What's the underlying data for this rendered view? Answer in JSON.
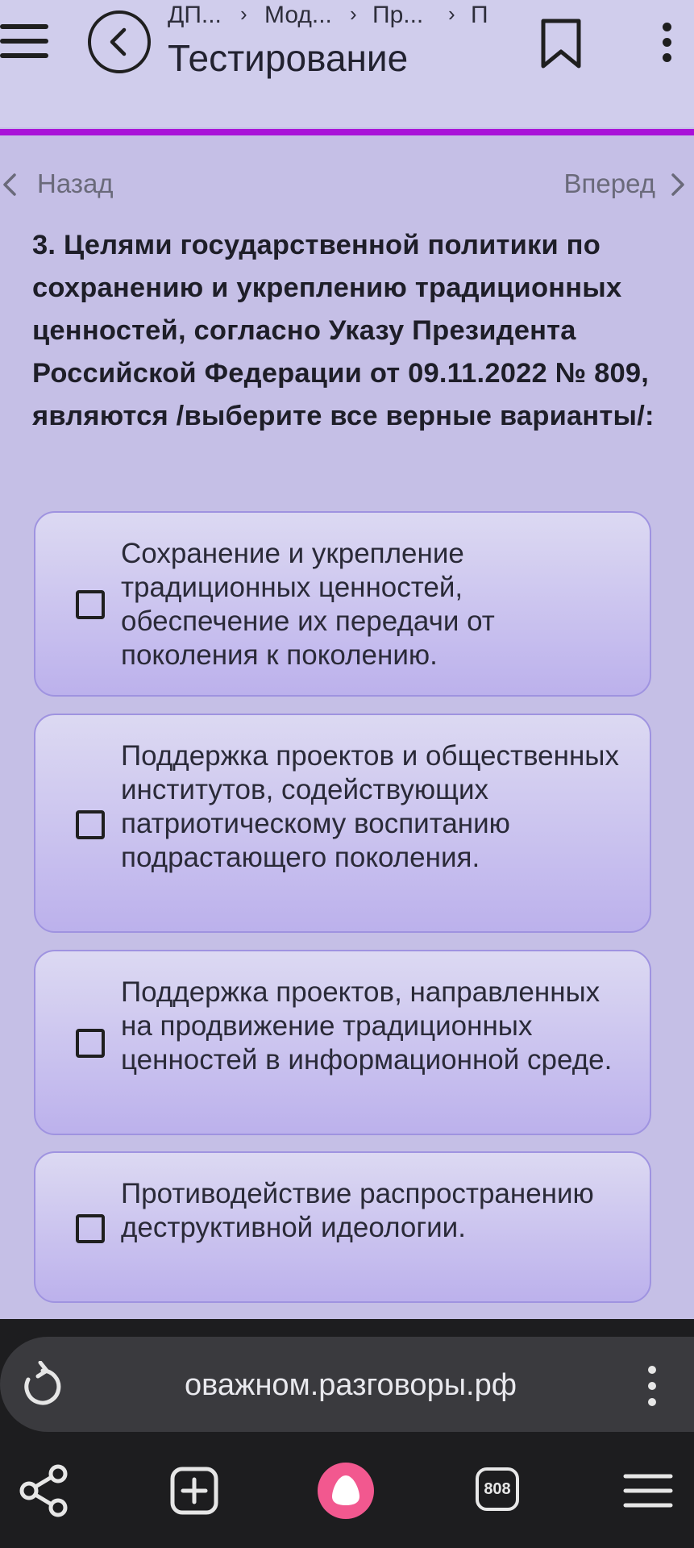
{
  "header": {
    "breadcrumb": [
      "ДП...",
      "Мод...",
      "Пр...",
      "П"
    ],
    "breadcrumb_separator": "›",
    "title": "Тестирование"
  },
  "nav": {
    "back_label": "Назад",
    "forward_label": "Вперед"
  },
  "question": {
    "text": "3.  Целями государственной политики по сохранению и укреплению традиционных ценностей, согласно Указу Президента Российской Федерации от 09.11.2022 № 809, являются /выберите все верные варианты/:"
  },
  "options": [
    {
      "text": "Сохранение и укрепление традиционных ценностей, обеспечение их передачи от поколения к поколению.",
      "checked": false
    },
    {
      "text": "Поддержка проектов и общественных институтов, содействующих патриотическому воспитанию подрастающего поколения.",
      "checked": false
    },
    {
      "text": "Поддержка проектов, направленных на продвижение традиционных ценностей в информационной среде.",
      "checked": false
    },
    {
      "text": "Противодействие распространению деструктивной идеологии.",
      "checked": false
    }
  ],
  "browser": {
    "url": "оважном.разговоры.рф",
    "tabs_count": "808"
  },
  "colors": {
    "page_bg": "#c5bfe6",
    "header_bg": "#d0cdec",
    "progress_accent": "#a912d8",
    "option_border": "#9f93e0",
    "browser_bg": "#1d1d1f",
    "alice_button": "#f2588f"
  }
}
